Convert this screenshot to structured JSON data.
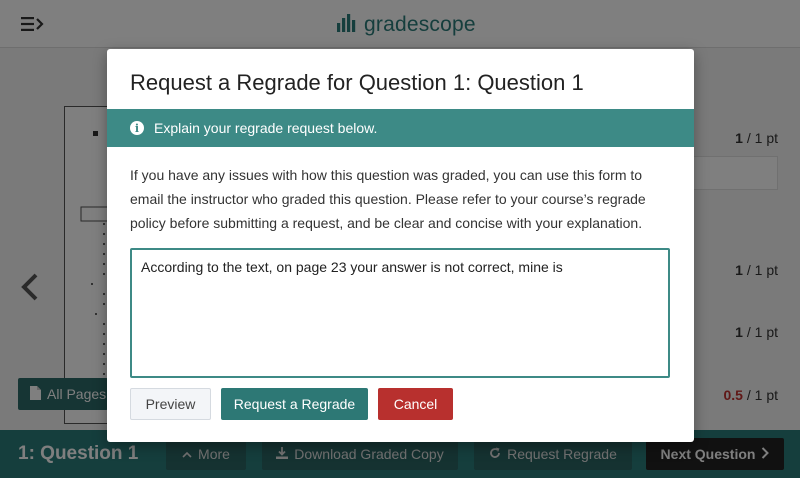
{
  "app": {
    "logo_text": "gradescope"
  },
  "sidebar": {
    "all_pages_label": "All Pages"
  },
  "scores": [
    {
      "got": "1",
      "total": "/ 1 pt"
    },
    {
      "got": "1",
      "total": "/ 1 pt"
    },
    {
      "got": "1",
      "total": "/ 1 pt"
    },
    {
      "got": "0.5",
      "total": "/ 1 pt"
    }
  ],
  "bottom_bar": {
    "question_title": "1: Question 1",
    "more_label": "More",
    "download_label": "Download Graded Copy",
    "request_regrade_label": "Request Regrade",
    "next_label": "Next Question"
  },
  "modal": {
    "title": "Request a Regrade for Question 1: Question 1",
    "banner_text": "Explain your regrade request below.",
    "description": "If you have any issues with how this question was graded, you can use this form to email the instructor who graded this question. Please refer to your course’s regrade policy before submitting a request, and be clear and concise with your explanation.",
    "request_text": "According to the text, on page 23 your answer is not correct, mine is",
    "preview_label": "Preview",
    "submit_label": "Request a Regrade",
    "cancel_label": "Cancel"
  },
  "colors": {
    "brand": "#2b7d7b",
    "banner": "#3d8a86",
    "danger": "#b8302e",
    "partial_score": "#c0302e"
  },
  "icons": {
    "menu": "menu-toggle-icon",
    "logo": "bar-chart-logo-icon",
    "info": "info-circle-icon",
    "prev": "chevron-left-icon",
    "all_pages": "document-icon",
    "more": "chevron-up-icon",
    "download": "download-icon",
    "regrade": "refresh-icon",
    "next": "chevron-right-icon"
  }
}
